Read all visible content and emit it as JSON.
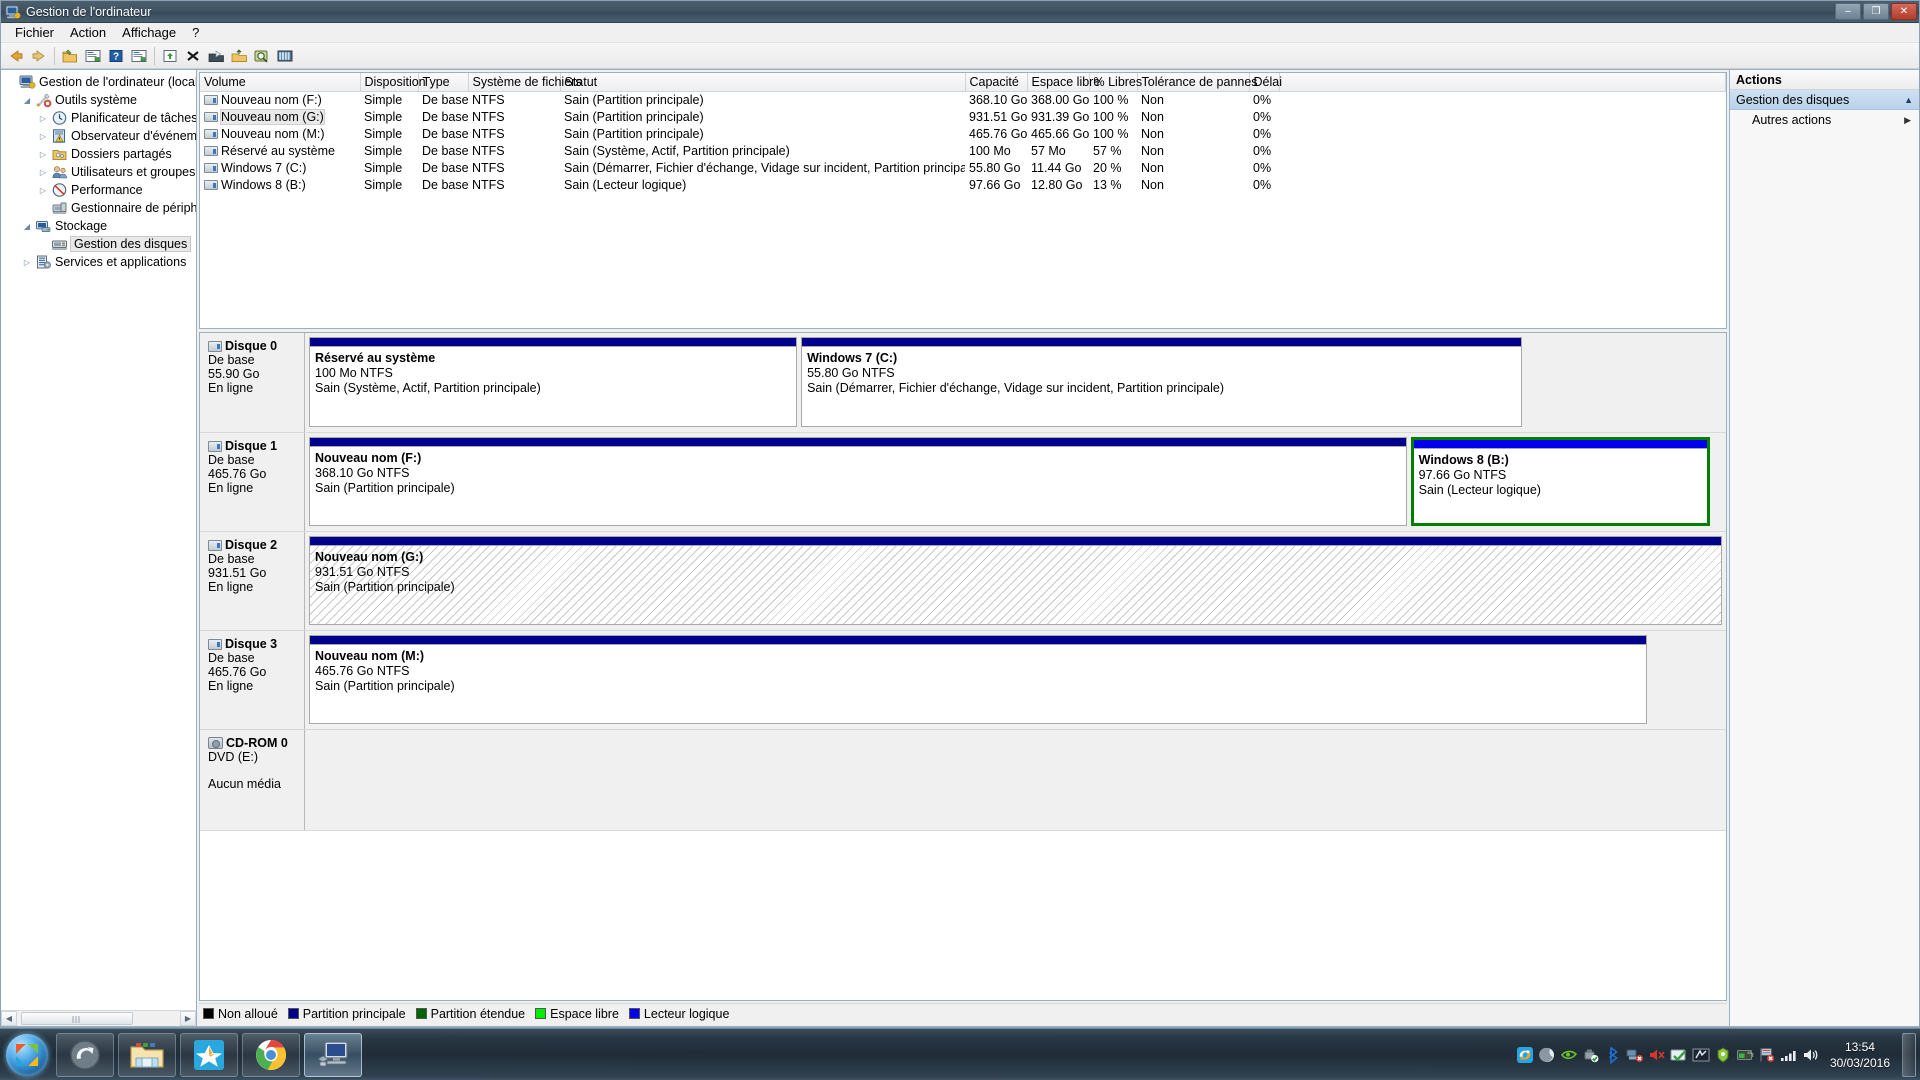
{
  "window": {
    "title": "Gestion de l'ordinateur",
    "icon": "computer-management-icon",
    "minimize_label": "–",
    "maximize_label": "❐",
    "close_label": "✕"
  },
  "menu": {
    "items": [
      "Fichier",
      "Action",
      "Affichage",
      "?"
    ]
  },
  "toolbar": {
    "buttons": [
      "back-arrow-icon",
      "forward-arrow-icon",
      "separator",
      "open-folder-icon",
      "properties-icon",
      "help-icon",
      "show-hide-console-tree-icon",
      "separator",
      "rescan-disks-icon",
      "delete-icon",
      "new-volume-icon",
      "extend-volume-icon",
      "zoom-icon",
      "optimize-icon"
    ]
  },
  "tree": {
    "items": [
      {
        "label": "Gestion de l'ordinateur (local)",
        "icon": "computer-icon",
        "indent": 0,
        "twisty": "",
        "selected": false
      },
      {
        "label": "Outils système",
        "icon": "tools-icon",
        "indent": 1,
        "twisty": "expanded",
        "selected": false
      },
      {
        "label": "Planificateur de tâches",
        "icon": "clock-icon",
        "indent": 2,
        "twisty": "collapsed",
        "selected": false
      },
      {
        "label": "Observateur d'événeme",
        "icon": "event-log-icon",
        "indent": 2,
        "twisty": "collapsed",
        "selected": false
      },
      {
        "label": "Dossiers partagés",
        "icon": "shared-folder-icon",
        "indent": 2,
        "twisty": "collapsed",
        "selected": false
      },
      {
        "label": "Utilisateurs et groupes l",
        "icon": "users-icon",
        "indent": 2,
        "twisty": "collapsed",
        "selected": false
      },
      {
        "label": "Performance",
        "icon": "performance-icon",
        "indent": 2,
        "twisty": "collapsed",
        "selected": false
      },
      {
        "label": "Gestionnaire de périphé",
        "icon": "device-manager-icon",
        "indent": 2,
        "twisty": "",
        "selected": false
      },
      {
        "label": "Stockage",
        "icon": "storage-icon",
        "indent": 1,
        "twisty": "expanded",
        "selected": false
      },
      {
        "label": "Gestion des disques",
        "icon": "disk-management-icon",
        "indent": 2,
        "twisty": "",
        "selected": true
      },
      {
        "label": "Services et applications",
        "icon": "services-icon",
        "indent": 1,
        "twisty": "collapsed",
        "selected": false
      }
    ]
  },
  "volume_table": {
    "columns": [
      "Volume",
      "Disposition",
      "Type",
      "Système de fichiers",
      "Statut",
      "Capacité",
      "Espace libre",
      "% Libres",
      "Tolérance de pannes",
      "Délai"
    ],
    "rows": [
      {
        "volume": "Nouveau nom (F:)",
        "disposition": "Simple",
        "type": "De base",
        "fs": "NTFS",
        "statut": "Sain (Partition principale)",
        "capacite": "368.10 Go",
        "libre": "368.00 Go",
        "pct": "100 %",
        "tolerance": "Non",
        "delai": "0%",
        "highlight": false
      },
      {
        "volume": "Nouveau nom (G:)",
        "disposition": "Simple",
        "type": "De base",
        "fs": "NTFS",
        "statut": "Sain (Partition principale)",
        "capacite": "931.51 Go",
        "libre": "931.39 Go",
        "pct": "100 %",
        "tolerance": "Non",
        "delai": "0%",
        "highlight": true
      },
      {
        "volume": "Nouveau nom (M:)",
        "disposition": "Simple",
        "type": "De base",
        "fs": "NTFS",
        "statut": "Sain (Partition principale)",
        "capacite": "465.76 Go",
        "libre": "465.66 Go",
        "pct": "100 %",
        "tolerance": "Non",
        "delai": "0%",
        "highlight": false
      },
      {
        "volume": "Réservé au système",
        "disposition": "Simple",
        "type": "De base",
        "fs": "NTFS",
        "statut": "Sain (Système, Actif, Partition principale)",
        "capacite": "100 Mo",
        "libre": "57 Mo",
        "pct": "57 %",
        "tolerance": "Non",
        "delai": "0%",
        "highlight": false
      },
      {
        "volume": "Windows 7 (C:)",
        "disposition": "Simple",
        "type": "De base",
        "fs": "NTFS",
        "statut": "Sain (Démarrer, Fichier d'échange, Vidage sur incident, Partition principale)",
        "capacite": "55.80 Go",
        "libre": "11.44 Go",
        "pct": "20 %",
        "tolerance": "Non",
        "delai": "0%",
        "highlight": false
      },
      {
        "volume": "Windows 8 (B:)",
        "disposition": "Simple",
        "type": "De base",
        "fs": "NTFS",
        "statut": "Sain (Lecteur logique)",
        "capacite": "97.66 Go",
        "libre": "12.80 Go",
        "pct": "13 %",
        "tolerance": "Non",
        "delai": "0%",
        "highlight": false
      }
    ]
  },
  "disks": [
    {
      "name": "Disque 0",
      "icon": "disk-icon",
      "type": "De base",
      "size": "55.90 Go",
      "status": "En ligne",
      "partitions": [
        {
          "name": "Réservé au système",
          "size_fs": "100 Mo NTFS",
          "status": "Sain (Système, Actif, Partition principale)",
          "flex": 100,
          "style": "primary"
        },
        {
          "name": "Windows 7  (C:)",
          "size_fs": "55.80 Go NTFS",
          "status": "Sain (Démarrer, Fichier d'échange, Vidage sur incident, Partition principale)",
          "flex": 148,
          "style": "primary"
        },
        {
          "name": "",
          "size_fs": "",
          "status": "",
          "flex": 39,
          "style": "empty"
        }
      ]
    },
    {
      "name": "Disque 1",
      "icon": "disk-icon",
      "type": "De base",
      "size": "465.76 Go",
      "status": "En ligne",
      "partitions": [
        {
          "name": "Nouveau nom  (F:)",
          "size_fs": "368.10 Go NTFS",
          "status": "Sain (Partition principale)",
          "flex": 366,
          "style": "primary"
        },
        {
          "name": "Windows 8  (B:)",
          "size_fs": "97.66 Go NTFS",
          "status": "Sain (Lecteur logique)",
          "flex": 98,
          "style": "extended"
        },
        {
          "name": "",
          "size_fs": "",
          "status": "",
          "flex": 2,
          "style": "empty"
        }
      ]
    },
    {
      "name": "Disque 2",
      "icon": "disk-icon",
      "type": "De base",
      "size": "931.51 Go",
      "status": "En ligne",
      "partitions": [
        {
          "name": "Nouveau nom  (G:)",
          "size_fs": "931.51 Go NTFS",
          "status": "Sain (Partition principale)",
          "flex": 100,
          "style": "hatched"
        }
      ]
    },
    {
      "name": "Disque 3",
      "icon": "disk-icon",
      "type": "De base",
      "size": "465.76 Go",
      "status": "En ligne",
      "partitions": [
        {
          "name": "Nouveau nom  (M:)",
          "size_fs": "465.76 Go NTFS",
          "status": "Sain (Partition principale)",
          "flex": 777,
          "style": "primary"
        },
        {
          "name": "",
          "size_fs": "",
          "status": "",
          "flex": 38,
          "style": "empty"
        }
      ]
    }
  ],
  "cdrom": {
    "name": "CD-ROM 0",
    "icon": "cdrom-icon",
    "letter": "DVD (E:)",
    "status": "Aucun média"
  },
  "legend": {
    "items": [
      {
        "label": "Non alloué",
        "color": "#000000"
      },
      {
        "label": "Partition principale",
        "color": "#00008b"
      },
      {
        "label": "Partition étendue",
        "color": "#006400"
      },
      {
        "label": "Espace libre",
        "color": "#00ee00"
      },
      {
        "label": "Lecteur logique",
        "color": "#0000ee"
      }
    ]
  },
  "actions": {
    "title": "Actions",
    "group": "Gestion des disques",
    "group_chevron": "▲",
    "items": [
      {
        "label": "Autres actions",
        "chevron": "▶"
      }
    ]
  },
  "taskbar": {
    "start": "start-orb-icon",
    "tasks": [
      {
        "icon": "shell-refresh-icon",
        "active": false
      },
      {
        "icon": "windows-explorer-icon",
        "active": false
      },
      {
        "icon": "media-player-icon",
        "active": false
      },
      {
        "icon": "google-chrome-icon",
        "active": false
      },
      {
        "icon": "computer-management-icon",
        "active": true
      }
    ],
    "tray_icons": [
      "sync-icon",
      "moon-icon",
      "nvidia-icon",
      "safely-remove-icon",
      "bluetooth-icon",
      "network-disconnected-icon",
      "volume-mute-icon",
      "green-check-icon",
      "monitor-icon",
      "shield-icon",
      "battery-icon",
      "flag-error-icon",
      "signal-bars-icon",
      "speaker-icon"
    ],
    "clock_time": "13:54",
    "clock_date": "30/03/2016"
  },
  "colors": {
    "primary_partition": "#00008b",
    "logical_drive": "#0000ee",
    "extended_border": "#008000",
    "free_space": "#00ee00",
    "unallocated": "#000000",
    "accent_selection": "#b9d2ea"
  }
}
